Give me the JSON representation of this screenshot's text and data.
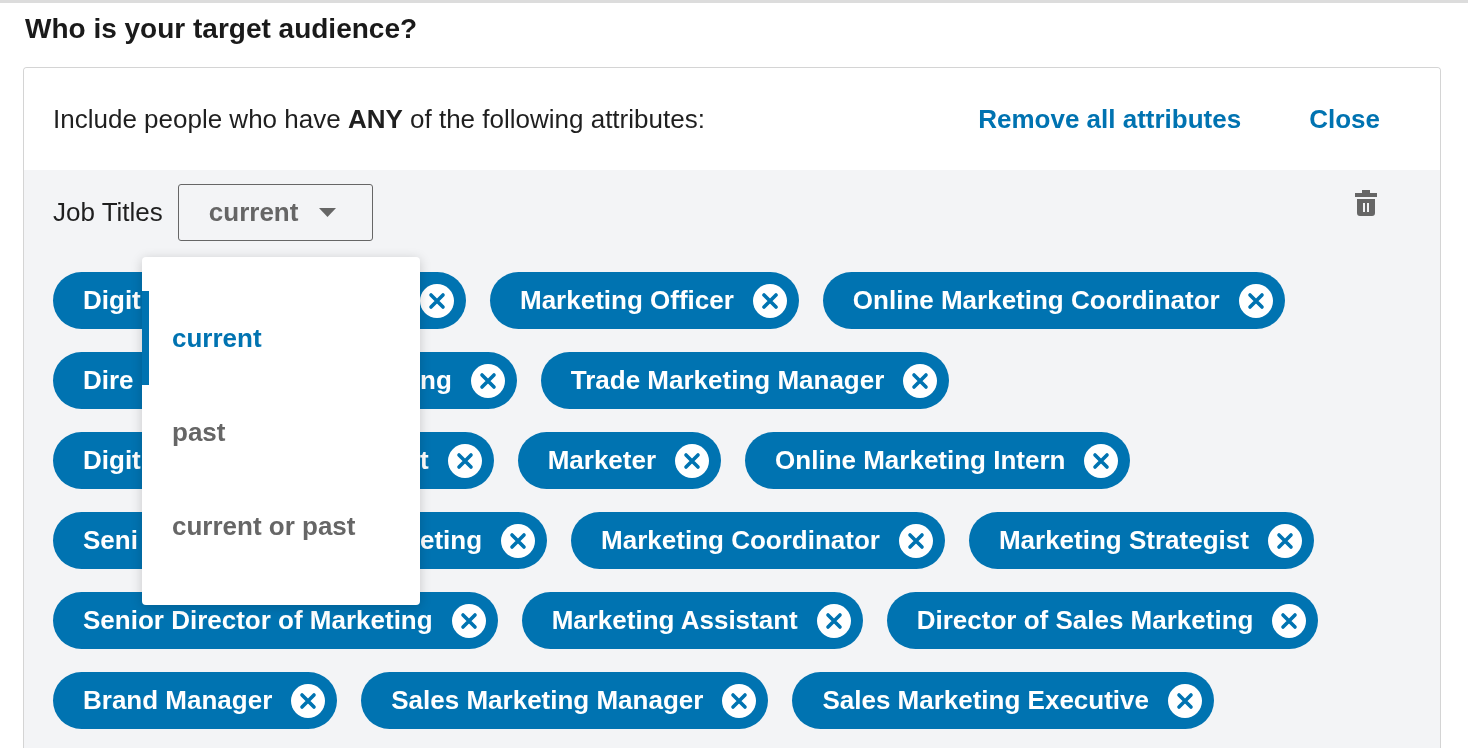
{
  "heading": "Who is your target audience?",
  "panel": {
    "intro": "Include people who have **ANY** of the following attributes:",
    "remove_all_link": "Remove all attributes",
    "close_link": "Close"
  },
  "attribute": {
    "label": "Job Titles",
    "select": {
      "value": "current",
      "expanded": true
    },
    "menu": [
      {
        "label": "current",
        "selected": true
      },
      {
        "label": "past",
        "selected": false
      },
      {
        "label": "current or past",
        "selected": false
      }
    ],
    "tags": [
      {
        "kind": "covered",
        "label": "Digit"
      },
      {
        "kind": "full",
        "label": "Marketing Officer"
      },
      {
        "kind": "full",
        "label": "Online Marketing Coordinator"
      },
      {
        "kind": "covered",
        "label": "Dire",
        "label_end": "ng"
      },
      {
        "kind": "full",
        "label": "Trade Marketing Manager"
      },
      {
        "kind": "covered",
        "label": "Digit",
        "label_end": "t"
      },
      {
        "kind": "full",
        "label": "Marketer"
      },
      {
        "kind": "full",
        "label": "Online Marketing Intern"
      },
      {
        "kind": "covered",
        "label": "Seni",
        "label_end": "eting"
      },
      {
        "kind": "full",
        "label": "Marketing Coordinator"
      },
      {
        "kind": "full",
        "label": "Marketing Strategist"
      },
      {
        "kind": "full",
        "label": "Senior Director of Marketing"
      },
      {
        "kind": "full",
        "label": "Marketing Assistant"
      },
      {
        "kind": "full",
        "label": "Director of Sales Marketing"
      },
      {
        "kind": "full",
        "label": "Brand Manager"
      },
      {
        "kind": "full",
        "label": "Sales Marketing Manager"
      },
      {
        "kind": "full",
        "label": "Sales Marketing Executive"
      }
    ]
  }
}
